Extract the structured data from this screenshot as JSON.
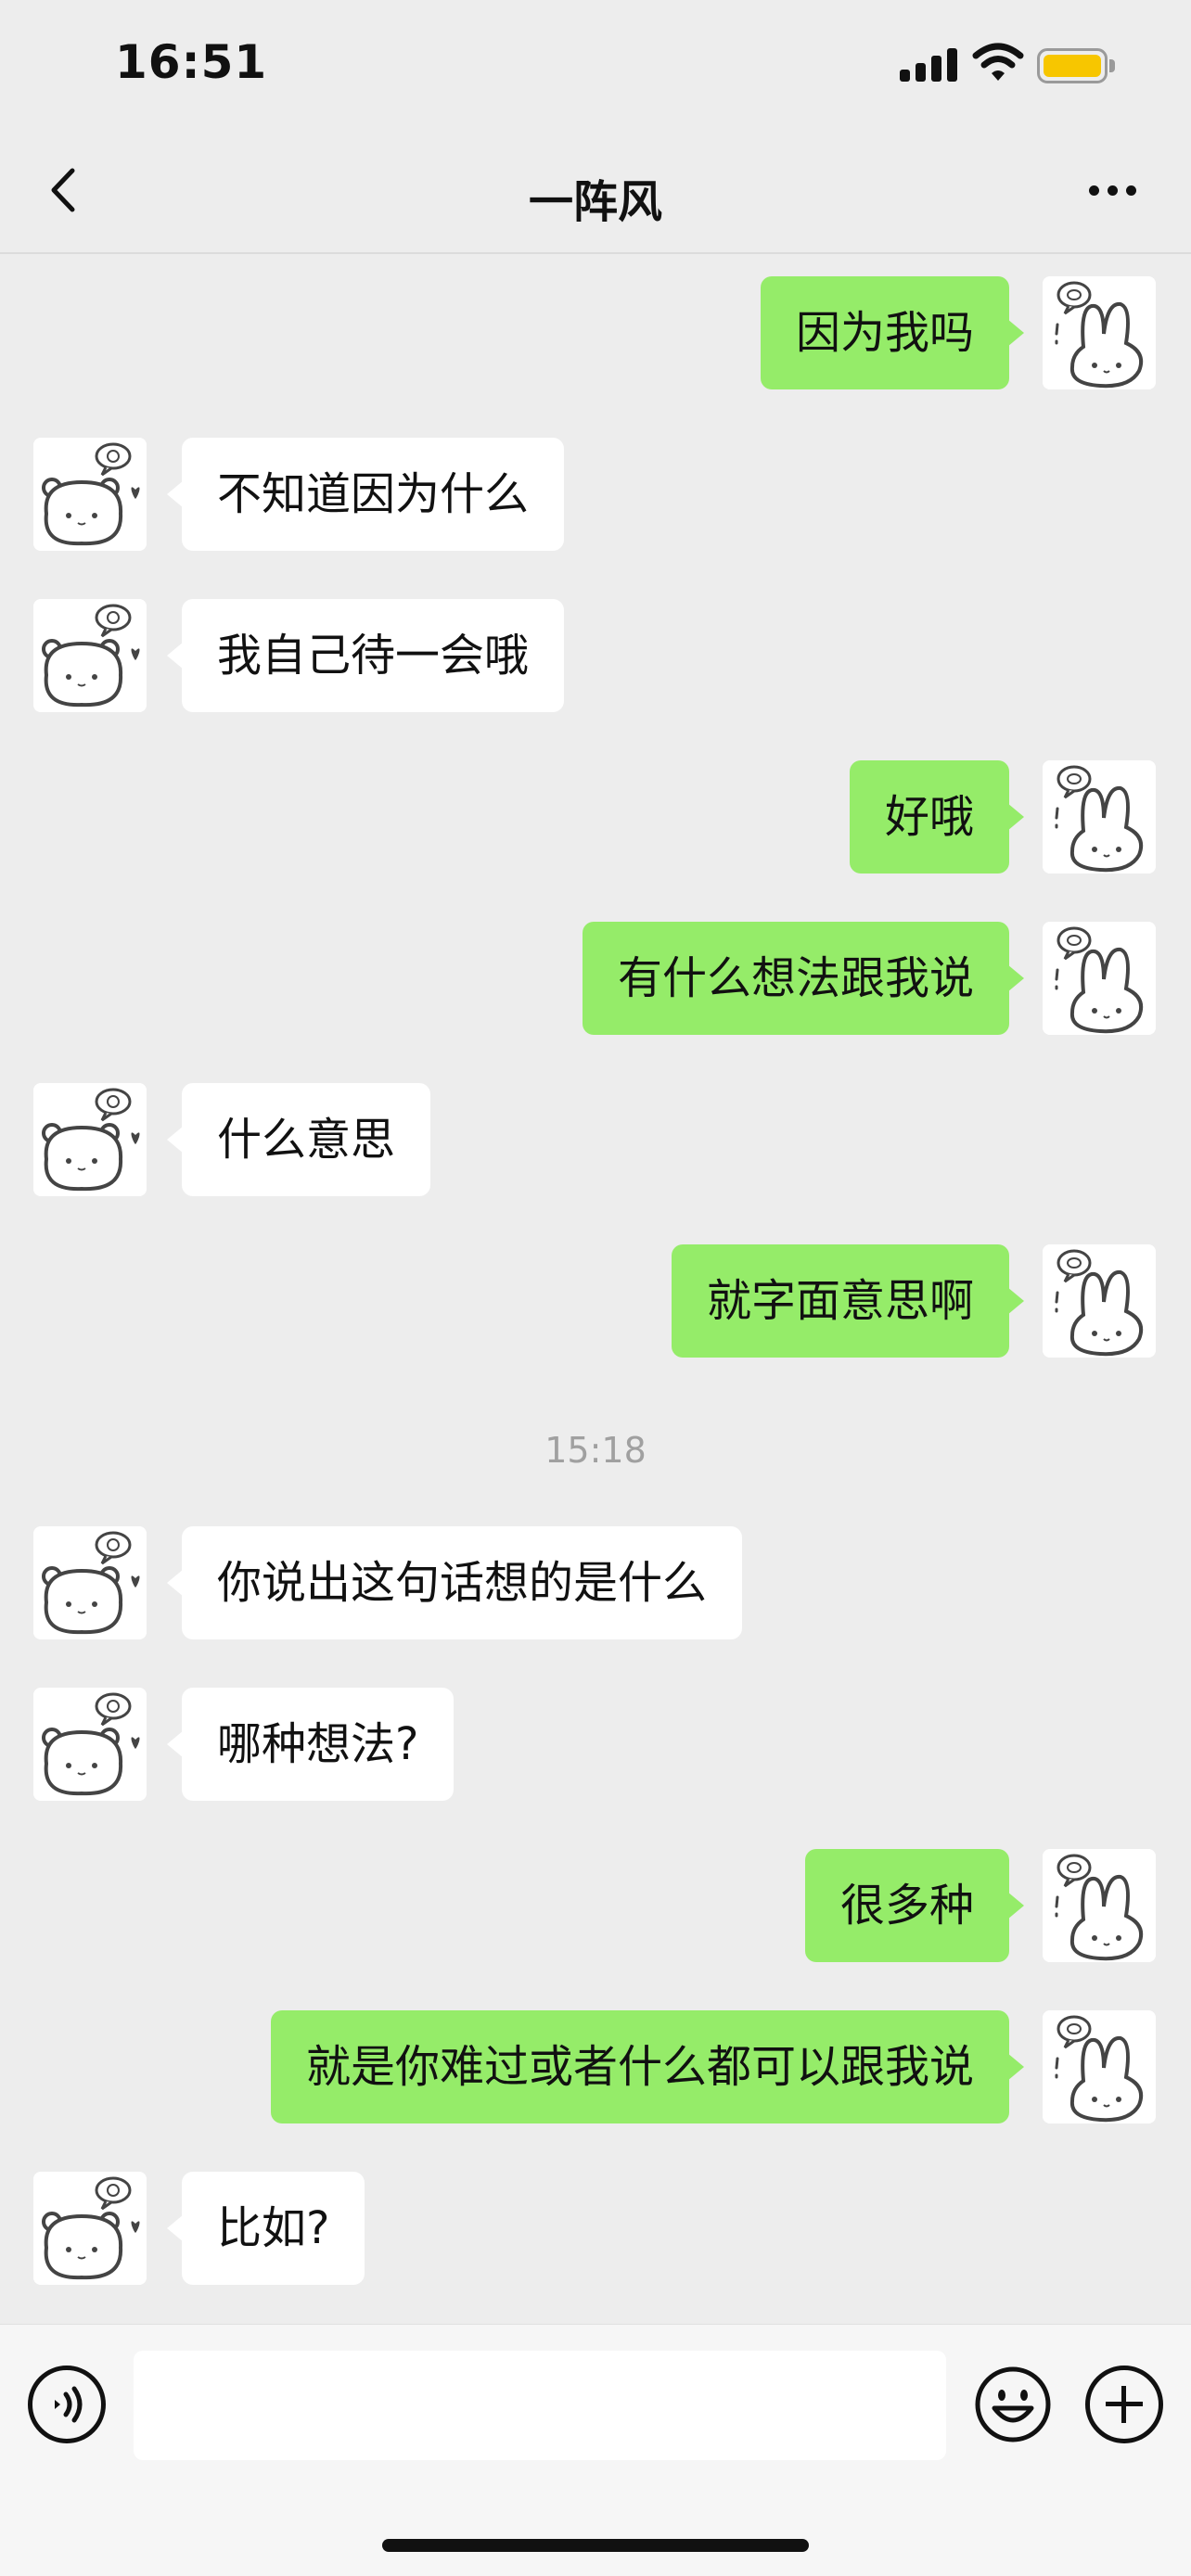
{
  "status_bar": {
    "time": "16:51",
    "battery_color": "#f7c600"
  },
  "nav": {
    "title": "一阵风",
    "back_icon": "chevron-left-icon",
    "more_icon": "more-dots-icon"
  },
  "timestamp": "15:18",
  "messages": [
    {
      "side": "sent",
      "text": "因为我吗"
    },
    {
      "side": "recv",
      "text": "不知道因为什么"
    },
    {
      "side": "recv",
      "text": "我自己待一会哦"
    },
    {
      "side": "sent",
      "text": "好哦"
    },
    {
      "side": "sent",
      "text": "有什么想法跟我说"
    },
    {
      "side": "recv",
      "text": "什么意思"
    },
    {
      "side": "sent",
      "text": "就字面意思啊"
    },
    {
      "side": "recv",
      "text": "你说出这句话想的是什么"
    },
    {
      "side": "recv",
      "text": "哪种想法?"
    },
    {
      "side": "sent",
      "text": "很多种"
    },
    {
      "side": "sent",
      "text": "就是你难过或者什么都可以跟我说"
    },
    {
      "side": "recv",
      "text": "比如?"
    }
  ],
  "input": {
    "value": "",
    "placeholder": ""
  },
  "colors": {
    "sent_bubble": "#95ec69",
    "recv_bubble": "#ffffff",
    "background": "#ededed"
  },
  "icons": {
    "voice": "voice-icon",
    "emoji": "emoji-icon",
    "plus": "plus-icon"
  }
}
